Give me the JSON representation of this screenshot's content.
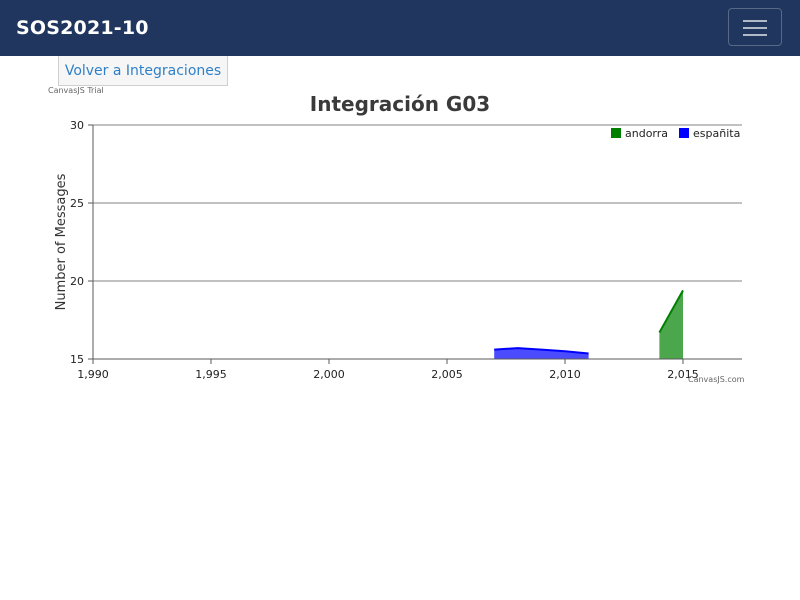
{
  "navbar": {
    "brand": "SOS2021-10",
    "toggler_icon": "hamburger-icon"
  },
  "back_button": {
    "label": "Volver a Integraciones"
  },
  "watermark": {
    "trial": "CanvasJS Trial",
    "credit": "CanvasJS.com"
  },
  "colors": {
    "navbar": "#21365e",
    "andorra": "#008000",
    "espanita": "#0000ff",
    "link": "#2f80c8"
  },
  "chart_data": {
    "type": "area",
    "title": "Integración G03",
    "xlabel": "",
    "ylabel": "Number of Messages",
    "xlim": [
      1990,
      2017.5
    ],
    "ylim": [
      15,
      30
    ],
    "x_ticks": [
      1990,
      1995,
      2000,
      2005,
      2010,
      2015
    ],
    "x_tick_labels": [
      "1,990",
      "1,995",
      "2,000",
      "2,005",
      "2,010",
      "2,015"
    ],
    "y_ticks": [
      15,
      20,
      25,
      30
    ],
    "y_tick_labels": [
      "15",
      "20",
      "25",
      "30"
    ],
    "grid": true,
    "legend_position": "top-right",
    "series": [
      {
        "name": "andorra",
        "color": "#008000",
        "x": [
          2014,
          2015
        ],
        "y": [
          16.7,
          19.4
        ]
      },
      {
        "name": "españita",
        "color": "#0000ff",
        "x": [
          2007,
          2008,
          2009,
          2010,
          2011
        ],
        "y": [
          15.6,
          15.7,
          15.6,
          15.5,
          15.35
        ]
      }
    ]
  }
}
